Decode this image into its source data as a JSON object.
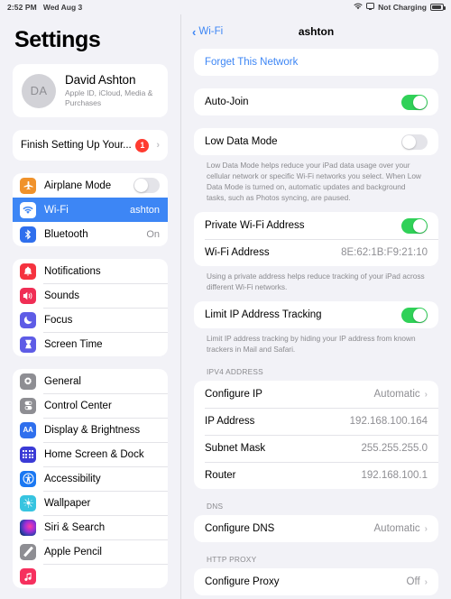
{
  "status_bar": {
    "time": "2:52 PM",
    "date": "Wed Aug 3",
    "wifi_icon": "wifi-icon",
    "screen_mirror_icon": "screen-mirror-icon",
    "battery_label": "Not Charging",
    "battery_icon": "battery-icon"
  },
  "sidebar": {
    "title": "Settings",
    "account": {
      "initials": "DA",
      "name": "David Ashton",
      "subtitle": "Apple ID, iCloud, Media & Purchases"
    },
    "finish_setup": {
      "label": "Finish Setting Up Your...",
      "badge": "1",
      "chevron": "›"
    },
    "groups": [
      {
        "items": [
          {
            "label": "Airplane Mode",
            "icon": "airplane-icon",
            "color": "#f0922b",
            "control": "toggle",
            "toggle": "off",
            "value": "",
            "selected": false
          },
          {
            "label": "Wi-Fi",
            "icon": "wifi-icon",
            "color": "#3d86f5",
            "control": "value",
            "toggle": "",
            "value": "ashton",
            "selected": true
          },
          {
            "label": "Bluetooth",
            "icon": "bluetooth-icon",
            "color": "#3d86f5",
            "control": "value",
            "toggle": "",
            "value": "On",
            "selected": false
          }
        ]
      },
      {
        "items": [
          {
            "label": "Notifications",
            "icon": "bell-icon",
            "color": "#f5333f",
            "control": "none",
            "toggle": "",
            "value": "",
            "selected": false
          },
          {
            "label": "Sounds",
            "icon": "speaker-icon",
            "color": "#f02e55",
            "control": "none",
            "toggle": "",
            "value": "",
            "selected": false
          },
          {
            "label": "Focus",
            "icon": "moon-icon",
            "color": "#5e5ce6",
            "control": "none",
            "toggle": "",
            "value": "",
            "selected": false
          },
          {
            "label": "Screen Time",
            "icon": "hourglass-icon",
            "color": "#5e5ce6",
            "control": "none",
            "toggle": "",
            "value": "",
            "selected": false
          }
        ]
      },
      {
        "items": [
          {
            "label": "General",
            "icon": "gear-icon",
            "color": "#8e8e93",
            "control": "none",
            "toggle": "",
            "value": "",
            "selected": false
          },
          {
            "label": "Control Center",
            "icon": "control-center-icon",
            "color": "#8e8e93",
            "control": "none",
            "toggle": "",
            "value": "",
            "selected": false
          },
          {
            "label": "Display & Brightness",
            "icon": "display-brightness-icon",
            "color": "#2f6fed",
            "control": "none",
            "toggle": "",
            "value": "",
            "selected": false
          },
          {
            "label": "Home Screen & Dock",
            "icon": "home-screen-icon",
            "color": "#3b3bd6",
            "control": "none",
            "toggle": "",
            "value": "",
            "selected": false
          },
          {
            "label": "Accessibility",
            "icon": "accessibility-icon",
            "color": "#1b78f2",
            "control": "none",
            "toggle": "",
            "value": "",
            "selected": false
          },
          {
            "label": "Wallpaper",
            "icon": "wallpaper-icon",
            "color": "#37c4e0",
            "control": "none",
            "toggle": "",
            "value": "",
            "selected": false
          },
          {
            "label": "Siri & Search",
            "icon": "siri-icon",
            "color": "#2b2b3d",
            "control": "none",
            "toggle": "",
            "value": "",
            "selected": false
          },
          {
            "label": "Apple Pencil",
            "icon": "apple-pencil-icon",
            "color": "#8e8e93",
            "control": "none",
            "toggle": "",
            "value": "",
            "selected": false
          },
          {
            "label": "",
            "icon": "music-icon",
            "color": "#f6305e",
            "control": "none",
            "toggle": "",
            "value": "",
            "selected": false
          }
        ]
      }
    ]
  },
  "detail": {
    "back_label": "Wi-Fi",
    "back_chevron": "‹",
    "title": "ashton",
    "forget_network_label": "Forget This Network",
    "auto_join": {
      "label": "Auto-Join",
      "toggle": "on"
    },
    "low_data_mode": {
      "label": "Low Data Mode",
      "toggle": "off"
    },
    "low_data_footnote": "Low Data Mode helps reduce your iPad data usage over your cellular network or specific Wi-Fi networks you select. When Low Data Mode is turned on, automatic updates and background tasks, such as Photos syncing, are paused.",
    "private_address": {
      "label": "Private Wi-Fi Address",
      "toggle": "on"
    },
    "wifi_address": {
      "label": "Wi-Fi Address",
      "value": "8E:62:1B:F9:21:10"
    },
    "private_footnote": "Using a private address helps reduce tracking of your iPad across different Wi-Fi networks.",
    "limit_ip_tracking": {
      "label": "Limit IP Address Tracking",
      "toggle": "on"
    },
    "limit_ip_footnote": "Limit IP address tracking by hiding your IP address from known trackers in Mail and Safari.",
    "ipv4_header": "IPV4 ADDRESS",
    "ipv4_rows": [
      {
        "label": "Configure IP",
        "value": "Automatic",
        "chevron": "›"
      },
      {
        "label": "IP Address",
        "value": "192.168.100.164",
        "chevron": ""
      },
      {
        "label": "Subnet Mask",
        "value": "255.255.255.0",
        "chevron": ""
      },
      {
        "label": "Router",
        "value": "192.168.100.1",
        "chevron": ""
      }
    ],
    "dns_header": "DNS",
    "dns_rows": [
      {
        "label": "Configure DNS",
        "value": "Automatic",
        "chevron": "›"
      }
    ],
    "proxy_header": "HTTP PROXY",
    "proxy_rows": [
      {
        "label": "Configure Proxy",
        "value": "Off",
        "chevron": "›"
      }
    ]
  },
  "colors": {
    "accent": "#3d86f5",
    "toggle_on": "#30d158",
    "badge_red": "#ff3b30",
    "background": "#f2f2f7"
  }
}
